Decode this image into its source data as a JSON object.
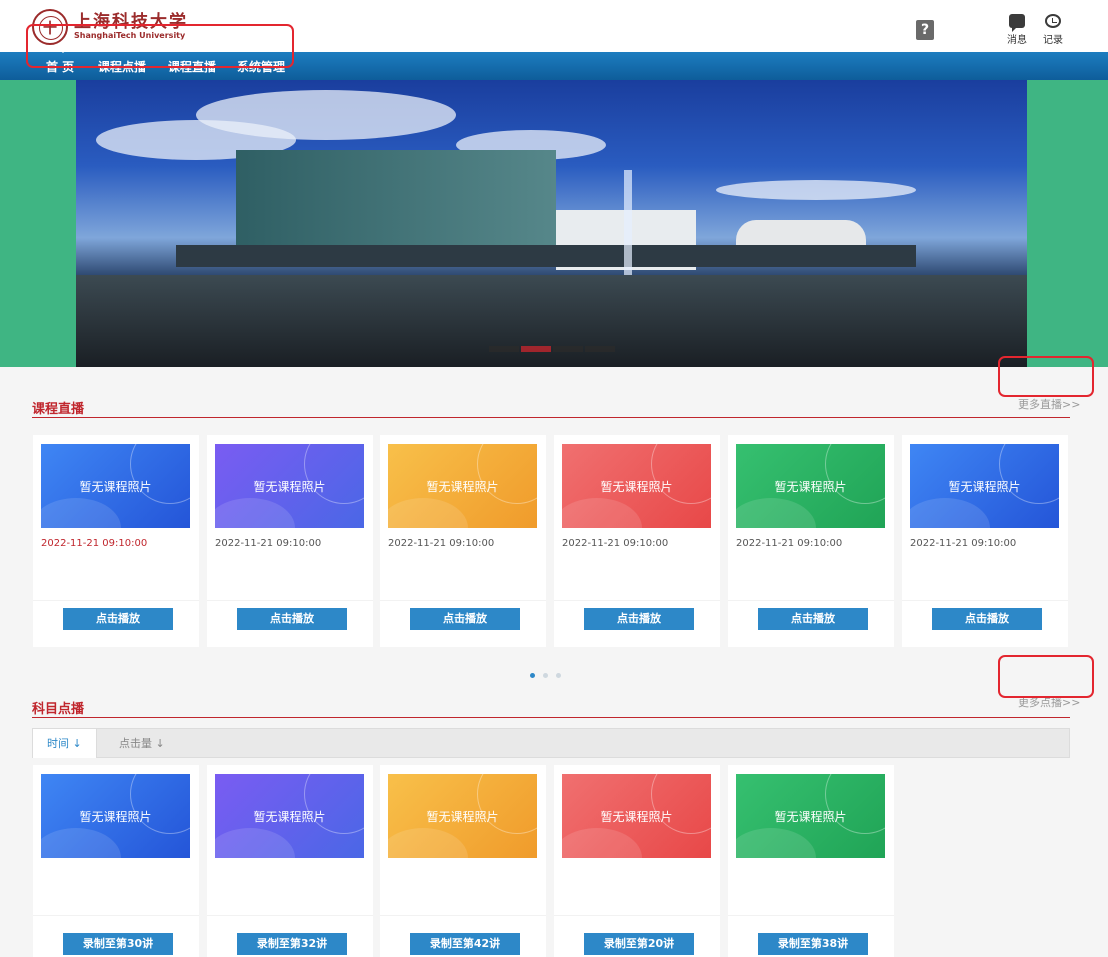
{
  "header": {
    "logo_cn": "上海科技大学",
    "logo_en": "ShanghaiTech University",
    "help_icon": "?",
    "messages_label": "消息",
    "records_label": "记录"
  },
  "nav": {
    "items": [
      {
        "label": "首 页"
      },
      {
        "label": "课程点播"
      },
      {
        "label": "课程直播"
      },
      {
        "label": "系统管理"
      }
    ]
  },
  "banner": {
    "slides": 4,
    "active_slide": 2
  },
  "live": {
    "title": "课程直播",
    "more": "更多直播>>",
    "cards": [
      {
        "thumb": "暂无课程照片",
        "time": "2022-11-21 09:10:00",
        "button": "点击播放",
        "color": "blue"
      },
      {
        "thumb": "暂无课程照片",
        "time": "2022-11-21 09:10:00",
        "button": "点击播放",
        "color": "purple"
      },
      {
        "thumb": "暂无课程照片",
        "time": "2022-11-21 09:10:00",
        "button": "点击播放",
        "color": "orange"
      },
      {
        "thumb": "暂无课程照片",
        "time": "2022-11-21 09:10:00",
        "button": "点击播放",
        "color": "red"
      },
      {
        "thumb": "暂无课程照片",
        "time": "2022-11-21 09:10:00",
        "button": "点击播放",
        "color": "green"
      },
      {
        "thumb": "暂无课程照片",
        "time": "2022-11-21 09:10:00",
        "button": "点击播放",
        "color": "blue"
      }
    ],
    "pages": 3,
    "active_page": 1
  },
  "vod": {
    "title": "科目点播",
    "more": "更多点播>>",
    "tabs": [
      {
        "label": "时间 ↓"
      },
      {
        "label": "点击量 ↓"
      }
    ],
    "cards": [
      {
        "thumb": "暂无课程照片",
        "button": "录制至第30讲",
        "color": "blue"
      },
      {
        "thumb": "暂无课程照片",
        "button": "录制至第32讲",
        "color": "purple"
      },
      {
        "thumb": "暂无课程照片",
        "button": "录制至第42讲",
        "color": "orange"
      },
      {
        "thumb": "暂无课程照片",
        "button": "录制至第20讲",
        "color": "red"
      },
      {
        "thumb": "暂无课程照片",
        "button": "录制至第38讲",
        "color": "green"
      }
    ]
  },
  "colors": {
    "brand_red": "#c0262d",
    "nav_blue": "#1d7dc0",
    "button_blue": "#2d88c8",
    "banner_green": "#3fb583",
    "annotation_red": "#e3262f"
  }
}
